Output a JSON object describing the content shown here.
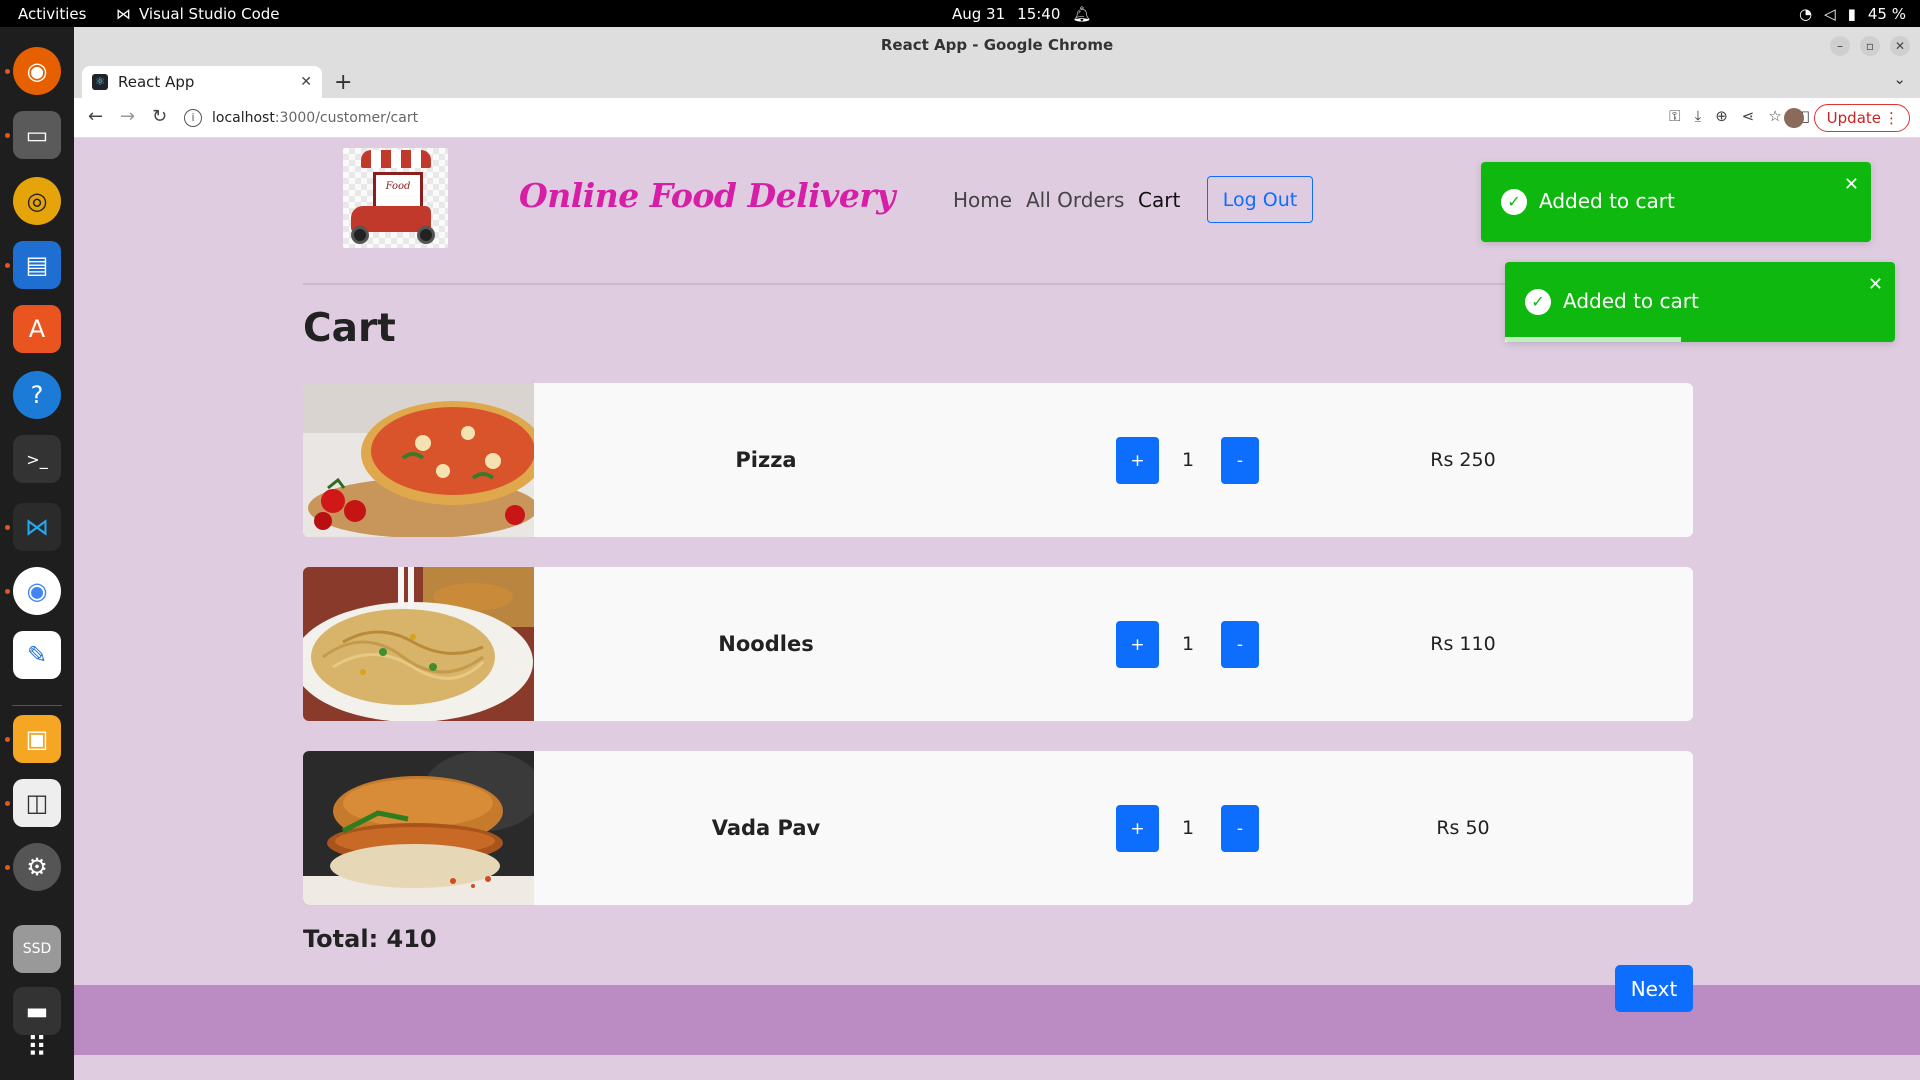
{
  "os": {
    "activities": "Activities",
    "app_name": "Visual Studio Code",
    "date": "Aug 31",
    "time": "15:40",
    "battery": "45 %"
  },
  "browser": {
    "window_title": "React App - Google Chrome",
    "tab_title": "React App",
    "url_host": "localhost",
    "url_path": ":3000/customer/cart",
    "update_label": "Update"
  },
  "site": {
    "brand": "Online Food Delivery",
    "logo_text": "Food",
    "nav": {
      "home": "Home",
      "orders": "All Orders",
      "cart": "Cart",
      "logout": "Log Out"
    }
  },
  "cart": {
    "title": "Cart",
    "plus_label": "+",
    "minus_label": "-",
    "items": [
      {
        "name": "Pizza",
        "qty": "1",
        "price": "Rs 250"
      },
      {
        "name": "Noodles",
        "qty": "1",
        "price": "Rs 110"
      },
      {
        "name": "Vada Pav",
        "qty": "1",
        "price": "Rs 50"
      }
    ],
    "total": "Total: 410",
    "next_label": "Next"
  },
  "toasts": [
    {
      "message": "Added to cart",
      "progress": 1.0
    },
    {
      "message": "Added to cart",
      "progress": 0.45
    }
  ],
  "colors": {
    "page_bg": "#dfcce0",
    "brand": "#d61fa6",
    "primary": "#0d6efd",
    "toast": "#0fb80f",
    "footer": "#bb8bc3"
  }
}
